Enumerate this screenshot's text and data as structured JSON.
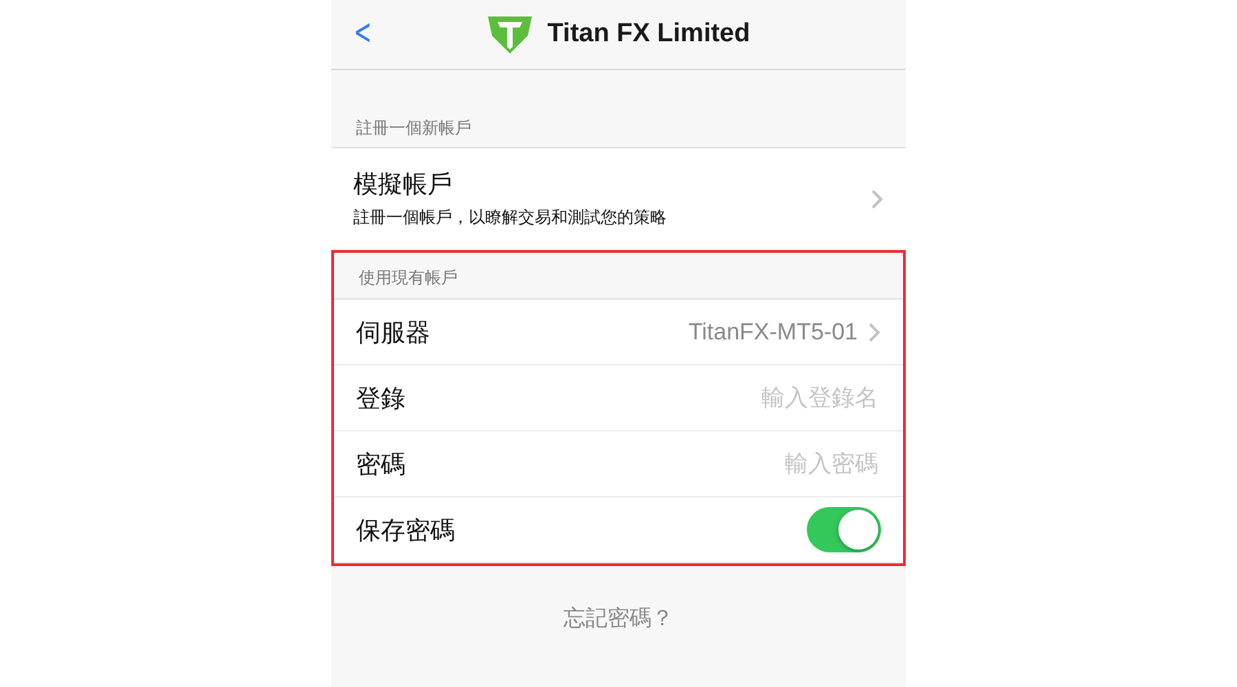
{
  "nav": {
    "back": "<",
    "title": "Titan FX Limited"
  },
  "sections": [
    {
      "header": "註冊一個新帳戶",
      "highlighted": false,
      "rows": [
        {
          "kind": "link",
          "label": "模擬帳戶",
          "subtitle": "註冊一個帳戶，以瞭解交易和測試您的策略"
        }
      ]
    },
    {
      "header": "使用現有帳戶",
      "highlighted": true,
      "rows": [
        {
          "kind": "link",
          "label": "伺服器",
          "value": "TitanFX-MT5-01"
        },
        {
          "kind": "input",
          "label": "登錄",
          "placeholder": "輸入登錄名"
        },
        {
          "kind": "input",
          "label": "密碼",
          "placeholder": "輸入密碼"
        },
        {
          "kind": "toggle",
          "label": "保存密碼",
          "on": true
        }
      ]
    }
  ],
  "footer_link": "忘記密碼？"
}
